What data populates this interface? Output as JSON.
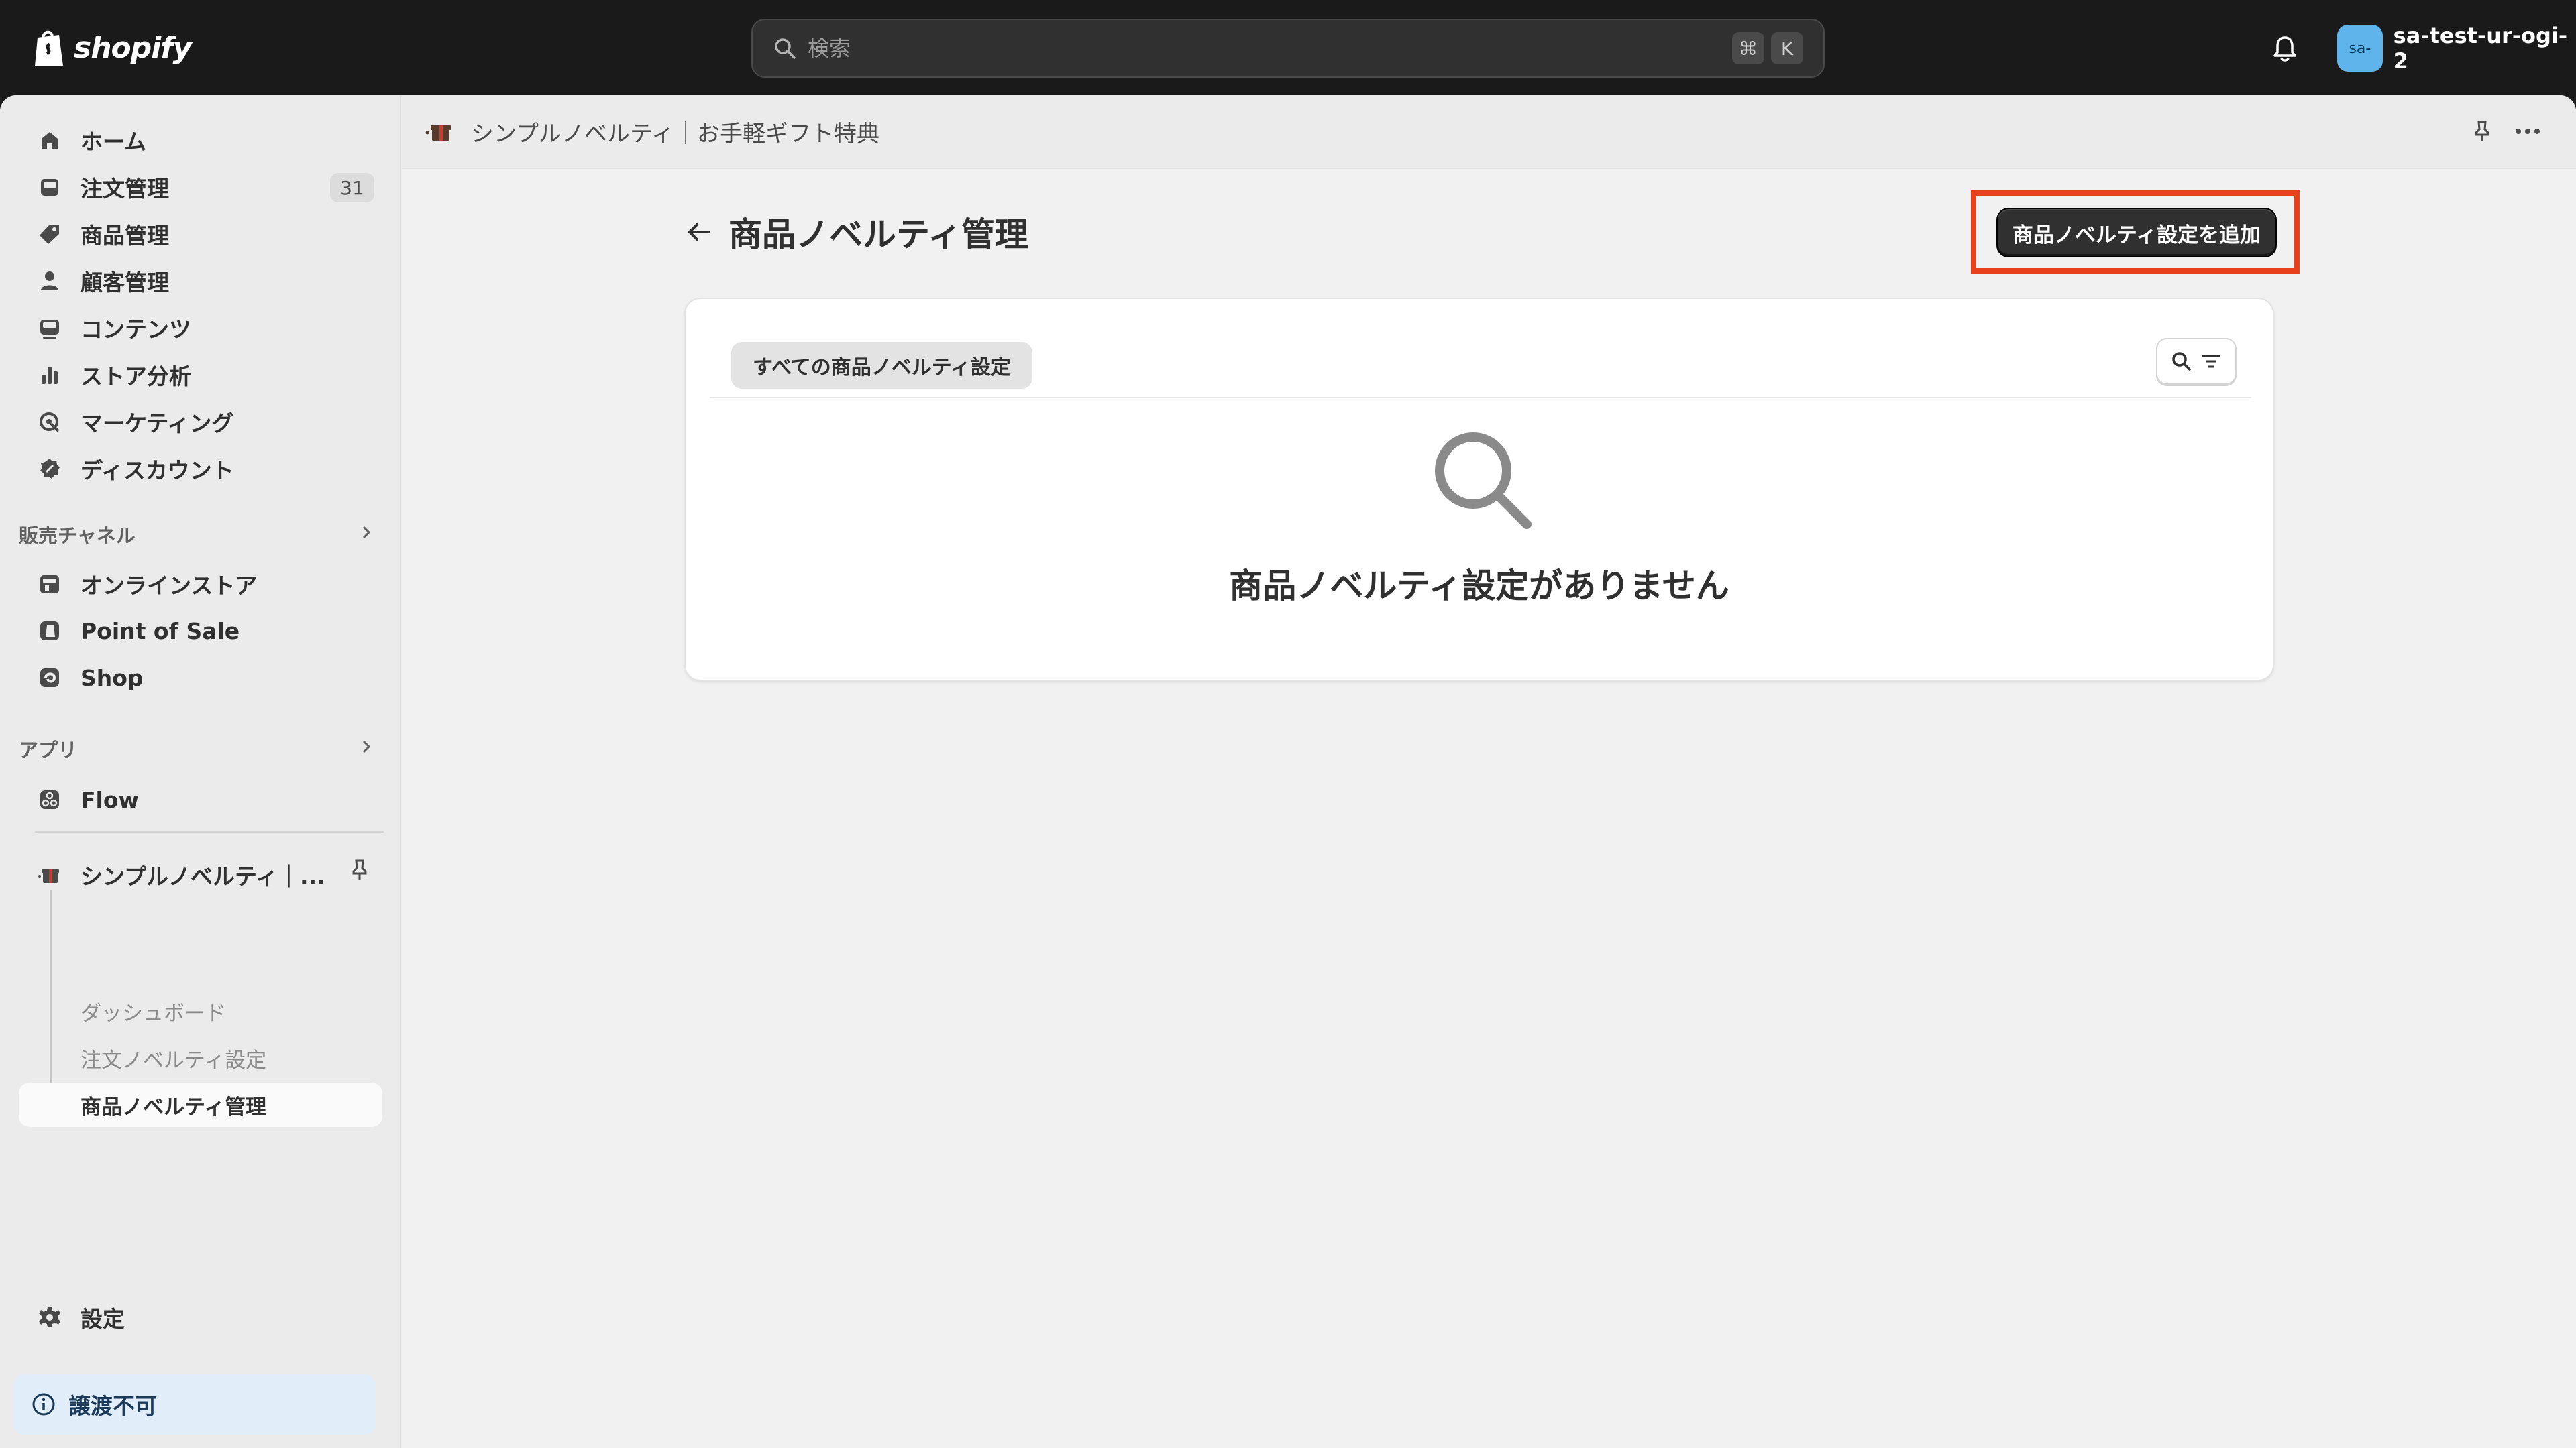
{
  "topbar": {
    "logo_text": "shopify",
    "search_placeholder": "検索",
    "shortcut_keys": [
      "⌘",
      "K"
    ],
    "account": {
      "avatar_text": "sa-",
      "name": "sa-test-ur-ogi-2"
    }
  },
  "sidebar": {
    "main_items": [
      {
        "label": "ホーム",
        "icon": "home-icon"
      },
      {
        "label": "注文管理",
        "icon": "orders-icon",
        "badge": "31"
      },
      {
        "label": "商品管理",
        "icon": "tag-icon"
      },
      {
        "label": "顧客管理",
        "icon": "person-icon"
      },
      {
        "label": "コンテンツ",
        "icon": "content-icon"
      },
      {
        "label": "ストア分析",
        "icon": "analytics-icon"
      },
      {
        "label": "マーケティング",
        "icon": "marketing-icon"
      },
      {
        "label": "ディスカウント",
        "icon": "discount-icon"
      }
    ],
    "sales_channels": {
      "title": "販売チャネル",
      "items": [
        {
          "label": "オンラインストア",
          "icon": "store-icon"
        },
        {
          "label": "Point of Sale",
          "icon": "pos-icon"
        },
        {
          "label": "Shop",
          "icon": "shop-icon"
        }
      ]
    },
    "apps": {
      "title": "アプリ",
      "items": [
        {
          "label": "Flow",
          "icon": "flow-icon"
        }
      ]
    },
    "pinned_app": {
      "label": "シンプルノベルティ｜...",
      "sub_items": [
        {
          "label": "ダッシュボード",
          "active": false
        },
        {
          "label": "注文ノベルティ設定",
          "active": false
        },
        {
          "label": "商品ノベルティ管理",
          "active": true
        }
      ]
    },
    "settings_label": "設定",
    "non_transferable_label": "譲渡不可"
  },
  "appbar": {
    "title": "シンプルノベルティ｜お手軽ギフト特典"
  },
  "page": {
    "title": "商品ノベルティ管理",
    "primary_action": "商品ノベルティ設定を追加",
    "tab_label": "すべての商品ノベルティ設定",
    "empty_state": "商品ノベルティ設定がありません"
  },
  "colors": {
    "highlight": "#e8401c",
    "avatar": "#5fb4ec",
    "primary_button": "#303030"
  }
}
